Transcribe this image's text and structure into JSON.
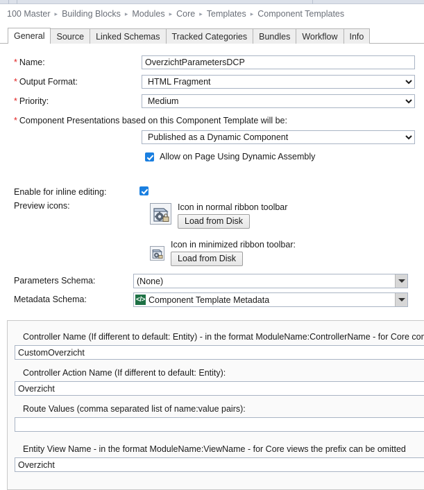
{
  "breadcrumb": {
    "separator": "▸",
    "items": [
      "100 Master",
      "Building Blocks",
      "Modules",
      "Core",
      "Templates",
      "Component Templates"
    ]
  },
  "tabs": [
    {
      "label": "General",
      "active": true
    },
    {
      "label": "Source",
      "active": false
    },
    {
      "label": "Linked Schemas",
      "active": false
    },
    {
      "label": "Tracked Categories",
      "active": false
    },
    {
      "label": "Bundles",
      "active": false
    },
    {
      "label": "Workflow",
      "active": false
    },
    {
      "label": "Info",
      "active": false
    }
  ],
  "form": {
    "name": {
      "label": "Name:",
      "required": "*",
      "value": "OverzichtParametersDCP"
    },
    "output_format": {
      "label": "Output Format:",
      "required": "*",
      "value": "HTML Fragment"
    },
    "priority": {
      "label": "Priority:",
      "required": "*",
      "value": "Medium"
    },
    "component_presentations": {
      "label": "Component Presentations based on this Component Template will be:",
      "required": "*",
      "value": "Published as a Dynamic Component"
    },
    "allow_dynamic_assembly": {
      "label": "Allow on Page Using Dynamic Assembly",
      "checked": true
    },
    "inline_editing": {
      "label": "Enable for inline editing:",
      "checked": true
    },
    "preview_icons": {
      "label": "Preview icons:",
      "normal": {
        "caption": "Icon in normal ribbon toolbar",
        "button": "Load from Disk",
        "icon": "gear-lock-document-icon"
      },
      "minimized": {
        "caption": "Icon in minimized ribbon toolbar:",
        "button": "Load from Disk",
        "icon": "gear-lock-document-small-icon"
      }
    },
    "parameters_schema": {
      "label": "Parameters Schema:",
      "value": "(None)"
    },
    "metadata_schema": {
      "label": "Metadata Schema:",
      "value": "Component Template Metadata",
      "icon": "code-schema-icon",
      "icon_glyph": "</>",
      "icon_color": "#1e7145"
    }
  },
  "metadata_panel": {
    "fields": [
      {
        "label": "Controller Name (If different to default: Entity) - in the format ModuleName:ControllerName - for Core controllers the prefix can be omitted",
        "value": "CustomOverzicht"
      },
      {
        "label": "Controller Action Name (If different to default: Entity):",
        "value": "Overzicht"
      },
      {
        "label": "Route Values (comma separated list of name:value pairs):",
        "value": ""
      },
      {
        "label": "Entity View Name - in the format ModuleName:ViewName - for Core views the prefix can be omitted",
        "value": "Overzicht"
      }
    ]
  },
  "colors": {
    "required_asterisk": "#e02222",
    "checkbox_accent": "#1a7fe0",
    "schema_icon": "#1e7145",
    "breadcrumb_text": "#6a6f78"
  }
}
